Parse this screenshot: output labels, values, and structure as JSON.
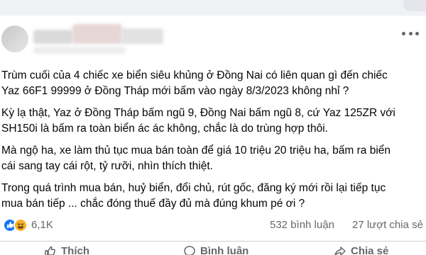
{
  "post": {
    "paragraphs": [
      "Trùm cuối của 4 chiếc xe biển siêu khủng ở Đồng Nai có liên quan gì đến chiếc\nYaz 66F1 99999 ở Đồng Tháp mới bấm vào ngày 8/3/2023 không nhỉ ?",
      "Kỳ lạ thật, Yaz ở Đồng Tháp bấm ngũ 9, Đồng Nai bấm ngũ 8, cứ Yaz 125ZR với\nSH150i là bấm ra toàn biển ác ác không, chắc là do trùng hợp thôi.",
      "Mà ngộ ha, xe làm thủ tục mua bán toàn để giá 10 triệu 20 triệu ha, bấm ra biển\ncái sang tay cái rột, tỷ rưỡi, nhìn thích thiệt.",
      "Trong quá trình mua bán, huỷ biển, đổi chủ, rút gốc, đăng ký mới rồi lại tiếp tục\nmua bán tiếp ... chắc đóng thuế đầy đủ mà đúng khum pé ơi ?"
    ]
  },
  "engagement": {
    "reaction_count": "6,1K",
    "comments": "532 bình luận",
    "shares": "27 lượt chia sẻ"
  },
  "actions": {
    "like": "Thích",
    "comment": "Bình luận",
    "share": "Chia sẻ"
  },
  "colors": {
    "like_blue": "#1877f2",
    "haha_yellow": "#f7b125",
    "muted_text": "#65676b"
  }
}
